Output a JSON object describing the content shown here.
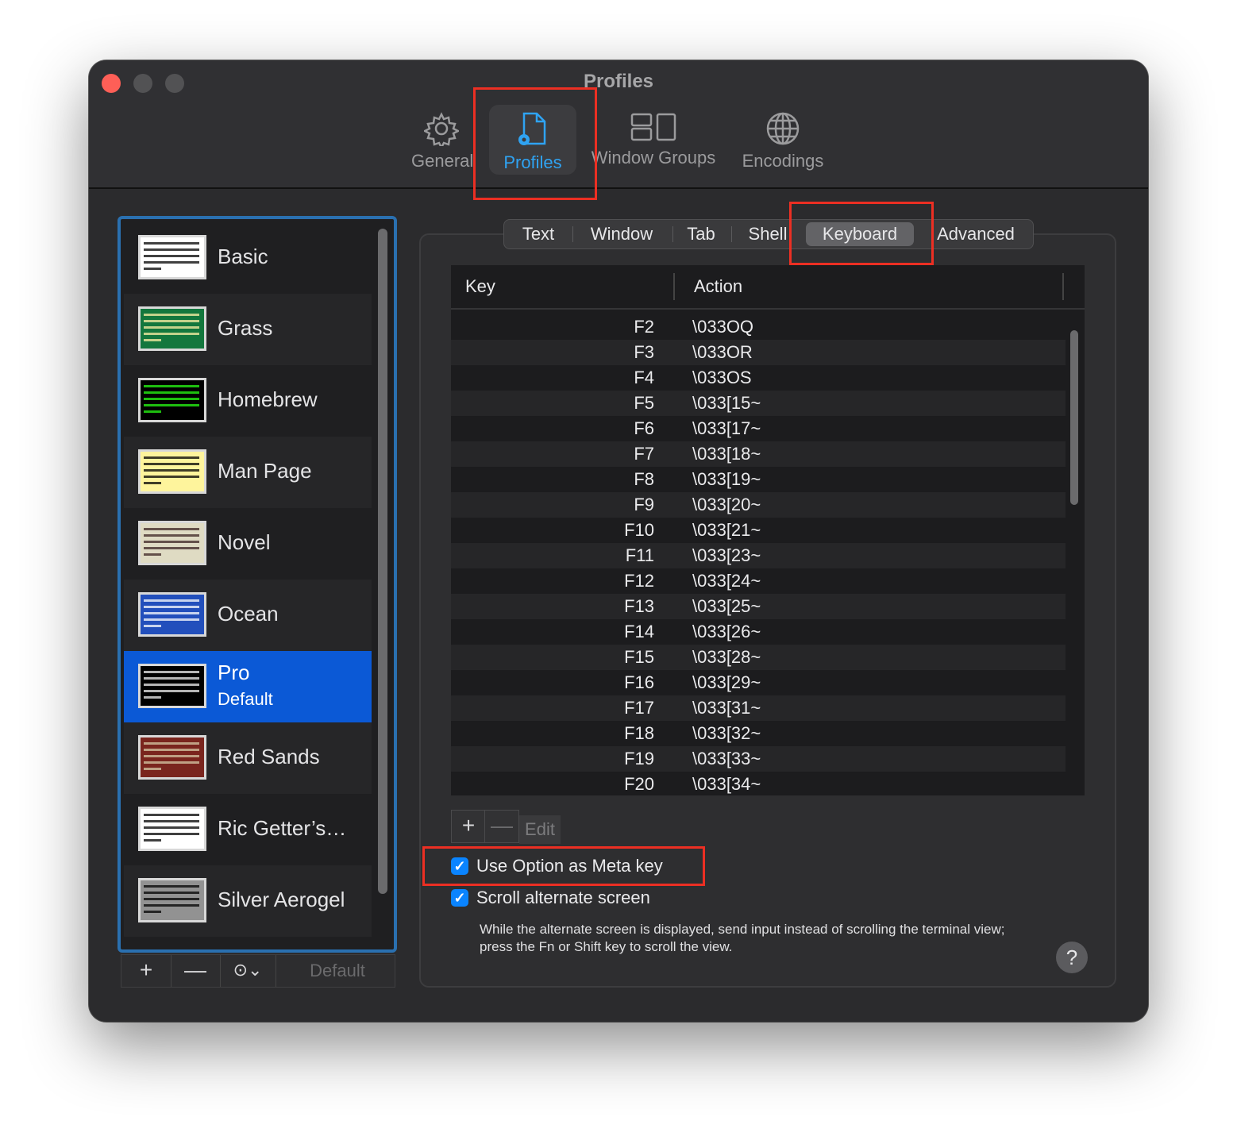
{
  "window": {
    "title": "Profiles"
  },
  "toolbar": {
    "items": [
      {
        "label": "General",
        "icon": "gear-icon"
      },
      {
        "label": "Profiles",
        "icon": "profile-document-icon",
        "active": true
      },
      {
        "label": "Window Groups",
        "icon": "window-groups-icon"
      },
      {
        "label": "Encodings",
        "icon": "globe-icon"
      }
    ]
  },
  "profiles": [
    {
      "name": "Basic",
      "theme": [
        "#ffffff",
        "#000000"
      ]
    },
    {
      "name": "Grass",
      "theme": [
        "#13773d",
        "#fff0a5"
      ]
    },
    {
      "name": "Homebrew",
      "theme": [
        "#000000",
        "#28fe14"
      ]
    },
    {
      "name": "Man Page",
      "theme": [
        "#fef49c",
        "#000000"
      ]
    },
    {
      "name": "Novel",
      "theme": [
        "#dfdbc3",
        "#3b2322"
      ]
    },
    {
      "name": "Ocean",
      "theme": [
        "#224fbc",
        "#ffffff"
      ]
    },
    {
      "name": "Pro",
      "subtitle": "Default",
      "theme": [
        "#000000",
        "#f2f2f2"
      ],
      "selected": true
    },
    {
      "name": "Red Sands",
      "theme": [
        "#7a251e",
        "#d7c9a7"
      ]
    },
    {
      "name": "Ric Getter’s…",
      "theme": [
        "#ffffff",
        "#000000"
      ]
    },
    {
      "name": "Silver Aerogel",
      "theme": [
        "#929292",
        "#000000"
      ]
    }
  ],
  "sidebar_buttons": {
    "add": "+",
    "remove": "—",
    "more": "⊙⌄",
    "default": "Default"
  },
  "tabs": [
    "Text",
    "Window",
    "Tab",
    "Shell",
    "Keyboard",
    "Advanced"
  ],
  "active_tab": "Keyboard",
  "table": {
    "headers": {
      "key": "Key",
      "action": "Action"
    },
    "rows": [
      {
        "key": "F2",
        "action": "\\033OQ"
      },
      {
        "key": "F3",
        "action": "\\033OR"
      },
      {
        "key": "F4",
        "action": "\\033OS"
      },
      {
        "key": "F5",
        "action": "\\033[15~"
      },
      {
        "key": "F6",
        "action": "\\033[17~"
      },
      {
        "key": "F7",
        "action": "\\033[18~"
      },
      {
        "key": "F8",
        "action": "\\033[19~"
      },
      {
        "key": "F9",
        "action": "\\033[20~"
      },
      {
        "key": "F10",
        "action": "\\033[21~"
      },
      {
        "key": "F11",
        "action": "\\033[23~"
      },
      {
        "key": "F12",
        "action": "\\033[24~"
      },
      {
        "key": "F13",
        "action": "\\033[25~"
      },
      {
        "key": "F14",
        "action": "\\033[26~"
      },
      {
        "key": "F15",
        "action": "\\033[28~"
      },
      {
        "key": "F16",
        "action": "\\033[29~"
      },
      {
        "key": "F17",
        "action": "\\033[31~"
      },
      {
        "key": "F18",
        "action": "\\033[32~"
      },
      {
        "key": "F19",
        "action": "\\033[33~"
      },
      {
        "key": "F20",
        "action": "\\033[34~"
      }
    ]
  },
  "table_buttons": {
    "add": "+",
    "remove": "—",
    "edit": "Edit"
  },
  "options": {
    "meta_key": {
      "label": "Use Option as Meta key",
      "checked": true
    },
    "scroll_alt": {
      "label": "Scroll alternate screen",
      "checked": true
    },
    "note": "While the alternate screen is displayed, send input instead of scrolling the terminal view; press the Fn or Shift key to scroll the view."
  },
  "help_label": "?",
  "colors": {
    "accent": "#0a84ff",
    "selection": "#0b59d6",
    "annotation": "#ec2f23",
    "profiles_tab": "#2fa3f2"
  }
}
